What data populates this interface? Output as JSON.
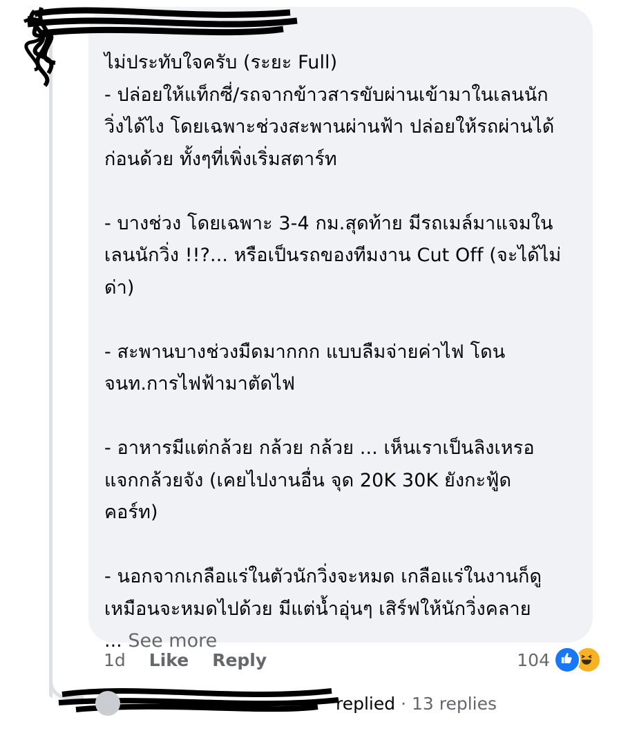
{
  "comment": {
    "paragraphs": [
      "ไม่ประทับใจครับ (ระยะ Full)\n- ปล่อยให้แท็กซี่/รถจากข้าวสารขับผ่านเข้ามาในเลนนัก\nวิ่งได้ไง โดยเฉพาะช่วงสะพานผ่านฟ้า ปล่อยให้รถผ่านได้\nก่อนด้วย ทั้งๆที่เพิ่งเริ่มสตาร์ท\n\n- บางช่วง โดยเฉพาะ 3-4 กม.สุดท้าย มีรถเมล์มาแจมใน\nเลนนักวิ่ง !!?... หรือเป็นรถของทีมงาน Cut Off (จะได้ไม่\nด่า)\n\n- สะพานบางช่วงมืดมากกก แบบลืมจ่ายค่าไฟ โดน\nจนท.การไฟฟ้ามาตัดไฟ\n\n- อาหารมีแต่กล้วย กล้วย กล้วย ... เห็นเราเป็นลิงเหรอ\nแจกกล้วยจัง (เคยไปงานอื่น จุด 20K 30K ยังกะฟู้ด\nคอร์ท)\n\n- นอกจากเกลือแร่ในตัวนักวิ่งจะหมด เกลือแร่ในงานก็ดู\nเหมือนจะหมดไปด้วย มีแต่น้ำอุ่นๆ เสิร์ฟให้นักวิ่งคลาย"
    ],
    "ellipsis": "... ",
    "see_more": "See more"
  },
  "actions": {
    "time": "1d",
    "like": "Like",
    "reply": "Reply"
  },
  "reactions": {
    "count": "104",
    "types": [
      "like-icon",
      "haha-icon"
    ],
    "like_color": "#1877f2",
    "haha_color": "#f7b125"
  },
  "replies": {
    "replied_label": "replied",
    "separator": " · ",
    "count_label": "13 replies"
  }
}
